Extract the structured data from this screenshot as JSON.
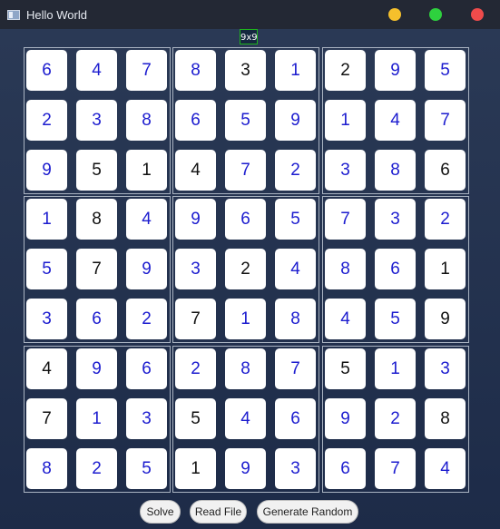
{
  "window": {
    "title": "Hello World",
    "controls": [
      {
        "name": "minimize",
        "color": "#f5c02c"
      },
      {
        "name": "maximize",
        "color": "#2ed13e"
      },
      {
        "name": "close",
        "color": "#ee4b4b"
      }
    ]
  },
  "board": {
    "size_label": "9x9",
    "cells": [
      [
        {
          "v": "6",
          "given": false
        },
        {
          "v": "4",
          "given": false
        },
        {
          "v": "7",
          "given": false
        },
        {
          "v": "8",
          "given": false
        },
        {
          "v": "3",
          "given": true
        },
        {
          "v": "1",
          "given": false
        },
        {
          "v": "2",
          "given": true
        },
        {
          "v": "9",
          "given": false
        },
        {
          "v": "5",
          "given": false
        }
      ],
      [
        {
          "v": "2",
          "given": false
        },
        {
          "v": "3",
          "given": false
        },
        {
          "v": "8",
          "given": false
        },
        {
          "v": "6",
          "given": false
        },
        {
          "v": "5",
          "given": false
        },
        {
          "v": "9",
          "given": false
        },
        {
          "v": "1",
          "given": false
        },
        {
          "v": "4",
          "given": false
        },
        {
          "v": "7",
          "given": false
        }
      ],
      [
        {
          "v": "9",
          "given": false
        },
        {
          "v": "5",
          "given": true
        },
        {
          "v": "1",
          "given": true
        },
        {
          "v": "4",
          "given": true
        },
        {
          "v": "7",
          "given": false
        },
        {
          "v": "2",
          "given": false
        },
        {
          "v": "3",
          "given": false
        },
        {
          "v": "8",
          "given": false
        },
        {
          "v": "6",
          "given": true
        }
      ],
      [
        {
          "v": "1",
          "given": false
        },
        {
          "v": "8",
          "given": true
        },
        {
          "v": "4",
          "given": false
        },
        {
          "v": "9",
          "given": false
        },
        {
          "v": "6",
          "given": false
        },
        {
          "v": "5",
          "given": false
        },
        {
          "v": "7",
          "given": false
        },
        {
          "v": "3",
          "given": false
        },
        {
          "v": "2",
          "given": false
        }
      ],
      [
        {
          "v": "5",
          "given": false
        },
        {
          "v": "7",
          "given": true
        },
        {
          "v": "9",
          "given": false
        },
        {
          "v": "3",
          "given": false
        },
        {
          "v": "2",
          "given": true
        },
        {
          "v": "4",
          "given": false
        },
        {
          "v": "8",
          "given": false
        },
        {
          "v": "6",
          "given": false
        },
        {
          "v": "1",
          "given": true
        }
      ],
      [
        {
          "v": "3",
          "given": false
        },
        {
          "v": "6",
          "given": false
        },
        {
          "v": "2",
          "given": false
        },
        {
          "v": "7",
          "given": true
        },
        {
          "v": "1",
          "given": false
        },
        {
          "v": "8",
          "given": false
        },
        {
          "v": "4",
          "given": false
        },
        {
          "v": "5",
          "given": false
        },
        {
          "v": "9",
          "given": true
        }
      ],
      [
        {
          "v": "4",
          "given": true
        },
        {
          "v": "9",
          "given": false
        },
        {
          "v": "6",
          "given": false
        },
        {
          "v": "2",
          "given": false
        },
        {
          "v": "8",
          "given": false
        },
        {
          "v": "7",
          "given": false
        },
        {
          "v": "5",
          "given": true
        },
        {
          "v": "1",
          "given": false
        },
        {
          "v": "3",
          "given": false
        }
      ],
      [
        {
          "v": "7",
          "given": true
        },
        {
          "v": "1",
          "given": false
        },
        {
          "v": "3",
          "given": false
        },
        {
          "v": "5",
          "given": true
        },
        {
          "v": "4",
          "given": false
        },
        {
          "v": "6",
          "given": false
        },
        {
          "v": "9",
          "given": false
        },
        {
          "v": "2",
          "given": false
        },
        {
          "v": "8",
          "given": true
        }
      ],
      [
        {
          "v": "8",
          "given": false
        },
        {
          "v": "2",
          "given": false
        },
        {
          "v": "5",
          "given": false
        },
        {
          "v": "1",
          "given": true
        },
        {
          "v": "9",
          "given": false
        },
        {
          "v": "3",
          "given": false
        },
        {
          "v": "6",
          "given": false
        },
        {
          "v": "7",
          "given": false
        },
        {
          "v": "4",
          "given": false
        }
      ]
    ]
  },
  "buttons": {
    "solve": "Solve",
    "read_file": "Read File",
    "generate_random": "Generate Random"
  },
  "colors": {
    "given_digit": "#111111",
    "solved_digit": "#1c1ccf"
  }
}
